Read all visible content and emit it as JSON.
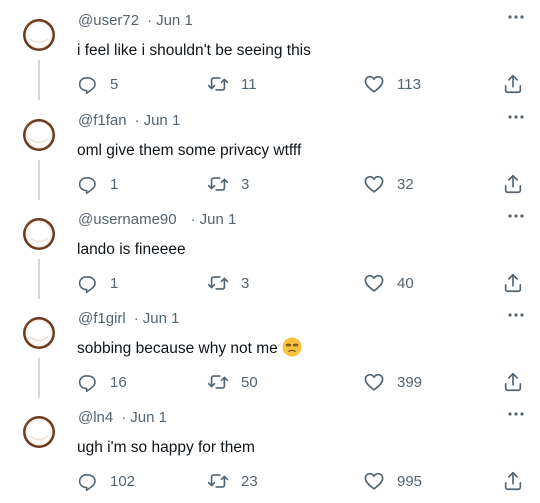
{
  "tweets": [
    {
      "handle": "@user72",
      "sep": "·",
      "date": "Jun 1",
      "text": "i feel like i shouldn't be seeing this",
      "replies": "5",
      "retweets": "11",
      "likes": "113"
    },
    {
      "handle": "@f1fan",
      "sep": "·",
      "date": "Jun 1",
      "text": "oml give them some privacy wtfff",
      "replies": "1",
      "retweets": "3",
      "likes": "32"
    },
    {
      "handle": "@username90",
      "sep": "·",
      "date": "Jun 1",
      "text": "lando is fineeee",
      "replies": "1",
      "retweets": "3",
      "likes": "40"
    },
    {
      "handle": "@f1girl",
      "sep": "·",
      "date": "Jun 1",
      "text": "sobbing because why not me",
      "emoji": "😒",
      "replies": "16",
      "retweets": "50",
      "likes": "399"
    },
    {
      "handle": "@ln4",
      "sep": "·",
      "date": "Jun 1",
      "text": "ugh i'm so happy for them",
      "replies": "102",
      "retweets": "23",
      "likes": "995"
    }
  ],
  "icons": {
    "avatar": "coconut-avatar-icon",
    "more": "more-options-icon",
    "reply": "reply-icon",
    "retweet": "retweet-icon",
    "like": "like-icon",
    "share": "share-icon"
  },
  "colors": {
    "text": "#0f1419",
    "muted": "#536471",
    "thread_line": "#cfd9de"
  }
}
